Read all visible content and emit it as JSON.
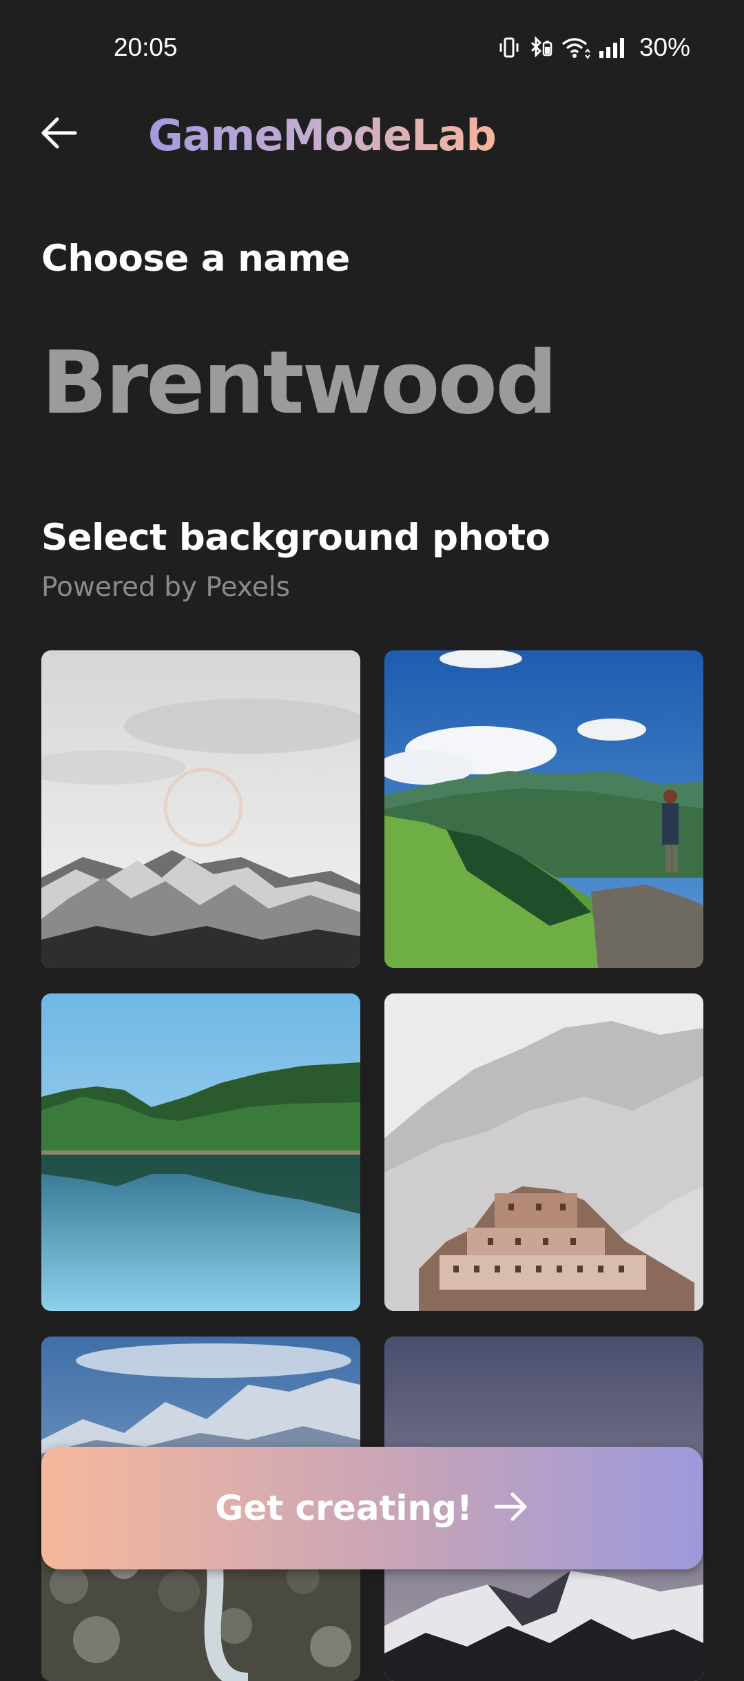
{
  "status_bar": {
    "time": "20:05",
    "battery": "30%",
    "icons": [
      "vibrate-icon",
      "bluetooth-icon",
      "wifi-icon",
      "signal-icon"
    ]
  },
  "app_bar": {
    "title": "GameModeLab",
    "back_icon": "arrow-left-icon"
  },
  "name_section": {
    "heading": "Choose a name",
    "name_value": "Brentwood"
  },
  "photo_section": {
    "heading": "Select background photo",
    "subheading": "Powered by Pexels",
    "photos": [
      "snowy-mountains-black-and-white",
      "hiker-on-green-mountain",
      "forest-lake-reflection",
      "monastery-on-snowy-mountain",
      "alpine-valley-river",
      "dusky-snow-peaks"
    ]
  },
  "cta": {
    "label": "Get creating!",
    "icon": "arrow-right-icon"
  },
  "colors": {
    "background": "#1f1f1f",
    "title_gradient_start": "#a49be0",
    "title_gradient_end": "#f5b69b",
    "cta_gradient_start": "#f6b89c",
    "cta_gradient_end": "#9d99dc",
    "name_text": "#9b9b9b"
  }
}
